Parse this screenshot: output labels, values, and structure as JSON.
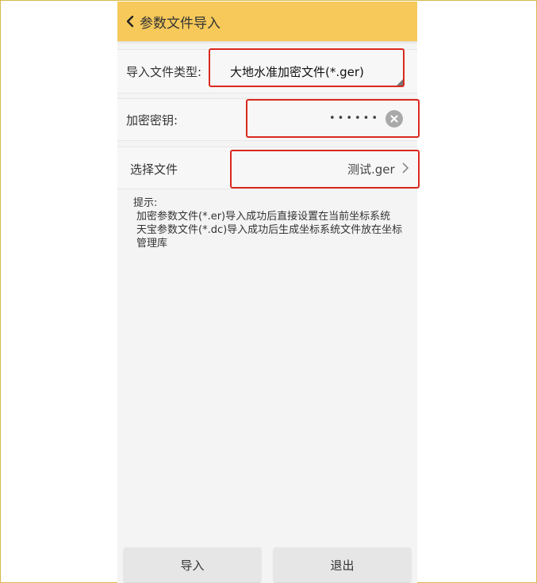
{
  "header": {
    "title": "参数文件导入"
  },
  "import_type": {
    "label": "导入文件类型:",
    "value": "大地水准加密文件(*.ger)"
  },
  "key": {
    "label": "加密密钥:",
    "masked": "••••••"
  },
  "file": {
    "label": "选择文件",
    "value": "测试.ger"
  },
  "hint": {
    "title": "提示:",
    "line1": "加密参数文件(*.er)导入成功后直接设置在当前坐标系统",
    "line2": "天宝参数文件(*.dc)导入成功后生成坐标系统文件放在坐标管理库"
  },
  "buttons": {
    "import": "导入",
    "exit": "退出"
  },
  "colors": {
    "header_bg": "#f6c95a",
    "highlight": "#d9291f"
  }
}
